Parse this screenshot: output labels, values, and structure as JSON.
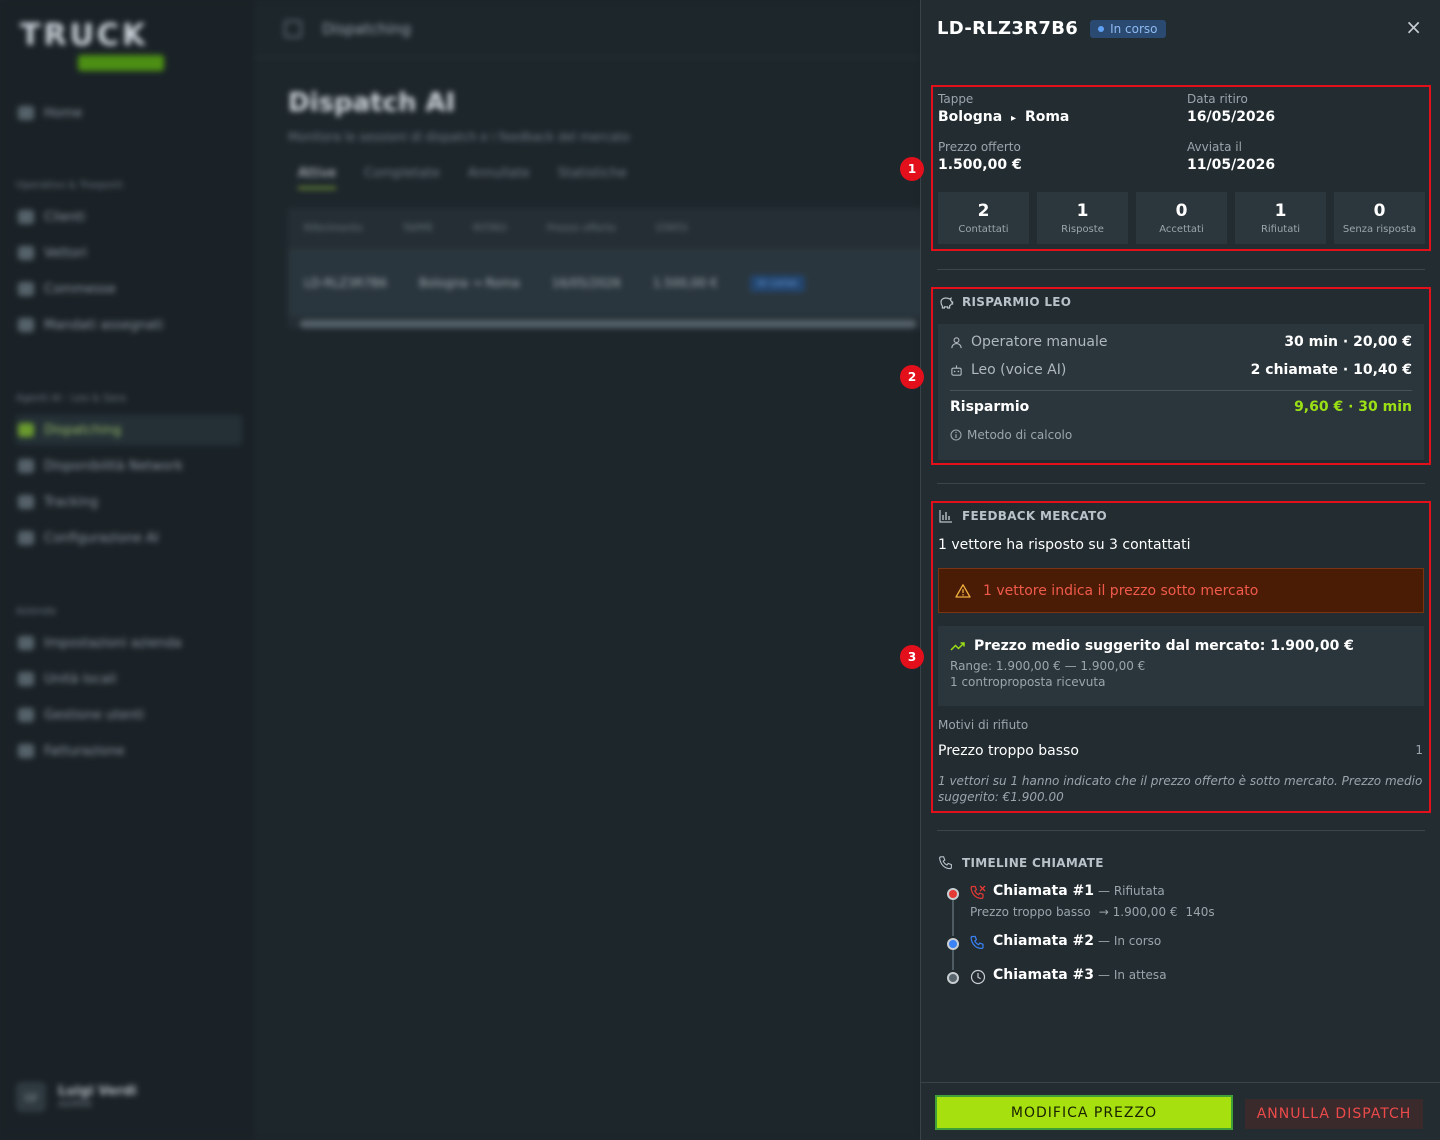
{
  "background": {
    "logo_text": "TRUCK",
    "sidebar": {
      "items_top": [
        "Home"
      ],
      "section1": "Operativo & Trasporti",
      "items1": [
        "Clienti",
        "Vettori",
        "Commesse",
        "Mandati assegnati"
      ],
      "section2": "Agenti AI - Leo & Sara",
      "items2": [
        "Dispatching",
        "Disponibilità Network",
        "Tracking",
        "Configurazione AI"
      ],
      "section3": "Azienda",
      "items3": [
        "Impostazioni azienda",
        "Unità locali",
        "Gestione utenti",
        "Fatturazione"
      ],
      "user_initials": "LV",
      "user_name": "Luigi Verdi",
      "user_role": "ADMIN"
    },
    "topbar_title": "Dispatching",
    "page_title": "Dispatch AI",
    "page_desc": "Monitora le sessioni di dispatch e i feedback del mercato",
    "tabs": [
      "Attive",
      "Completate",
      "Annullate",
      "Statistiche"
    ],
    "table_headers": [
      "Riferimento",
      "TAPPE",
      "RITIRO",
      "Prezzo offerto",
      "STATO"
    ],
    "table_row": [
      "LD-RLZ3R7B6",
      "Bologna → Roma",
      "16/05/2026",
      "1.500,00 €",
      "In corso"
    ]
  },
  "drawer": {
    "load_id": "LD-RLZ3R7B6",
    "status": "In corso",
    "close_icon": "×",
    "summary": {
      "tappe_label": "Tappe",
      "from": "Bologna",
      "arrow": "▸",
      "to": "Roma",
      "pickup_label": "Data ritiro",
      "pickup_date": "16/05/2026",
      "price_label": "Prezzo offerto",
      "price": "1.500,00 €",
      "started_label": "Avviata il",
      "started_date": "11/05/2026",
      "stats": [
        {
          "n": "2",
          "label": "Contattati"
        },
        {
          "n": "1",
          "label": "Risposte"
        },
        {
          "n": "0",
          "label": "Accettati"
        },
        {
          "n": "1",
          "label": "Rifiutati"
        },
        {
          "n": "0",
          "label": "Senza risposta"
        }
      ]
    },
    "savings": {
      "title": "RISPARMIO LEO",
      "manual_label": "Operatore manuale",
      "manual_value": "30 min · 20,00 €",
      "leo_label": "Leo (voice AI)",
      "leo_value": "2 chiamate · 10,40 €",
      "total_label": "Risparmio",
      "total_value": "9,60 € · 30 min",
      "method_label": "Metodo di calcolo"
    },
    "feedback": {
      "title": "FEEDBACK MERCATO",
      "summary": "1 vettore ha risposto su 3 contattati",
      "alert": "1 vettore indica il prezzo sotto mercato",
      "avg_price": "Prezzo medio suggerito dal mercato: 1.900,00 €",
      "range": "Range: 1.900,00 € — 1.900,00 €",
      "counter": "1 controproposta ricevuta",
      "reasons_label": "Motivi di rifiuto",
      "reason": "Prezzo troppo basso",
      "reason_count": "1",
      "note": "1 vettori su 1 hanno indicato che il prezzo offerto è sotto mercato. Prezzo medio suggerito: €1.900.00"
    },
    "timeline": {
      "title": "TIMELINE CHIAMATE",
      "calls": [
        {
          "title": "Chiamata #1",
          "status": "— Rifiutata",
          "reason": "Prezzo troppo basso",
          "counter": "→ 1.900,00 €",
          "duration": "140s",
          "color": "#e53935",
          "icon": "phone-missed-icon"
        },
        {
          "title": "Chiamata #2",
          "status": "— In corso",
          "color": "#3b82f6",
          "icon": "phone-icon"
        },
        {
          "title": "Chiamata #3",
          "status": "— In attesa",
          "color": "#5a666d",
          "icon": "clock-icon"
        }
      ]
    },
    "buttons": {
      "edit_price": "MODIFICA PREZZO",
      "cancel_dispatch": "ANNULLA DISPATCH"
    },
    "markers": [
      "1",
      "2",
      "3"
    ],
    "colors": {
      "accent_green": "#a6e00f",
      "highlight_red": "#e3101c",
      "savings_green": "#9be015",
      "status_blue": "#2a4a72"
    }
  }
}
